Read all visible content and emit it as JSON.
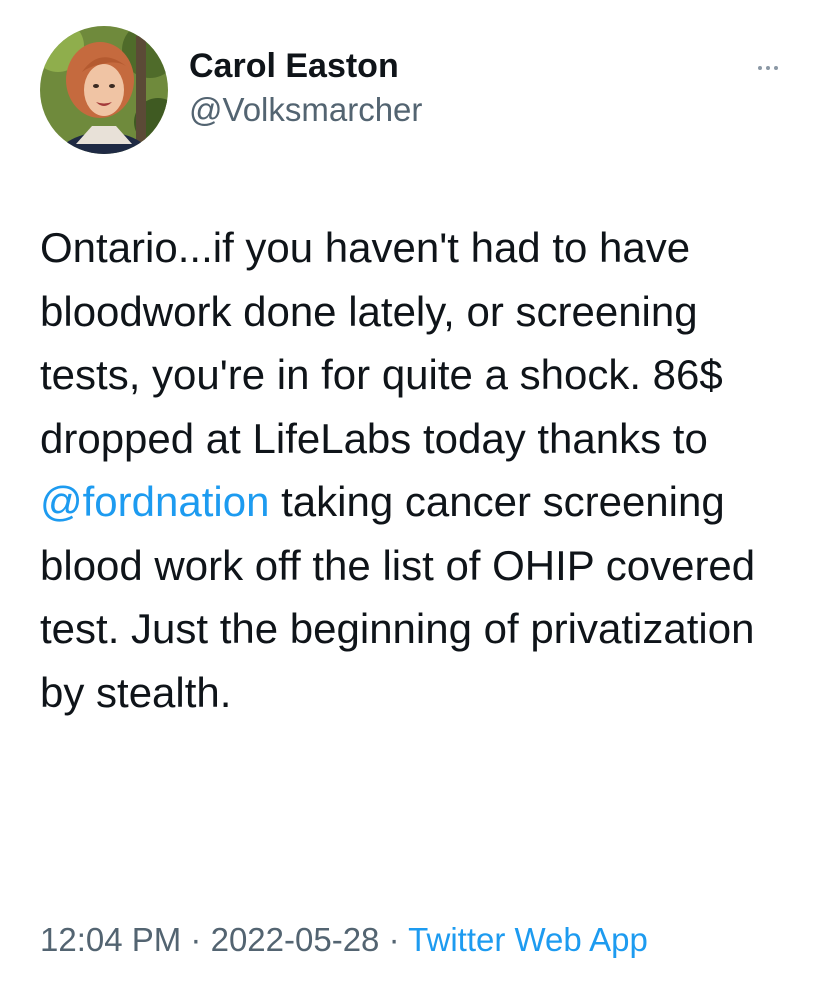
{
  "user": {
    "display_name": "Carol Easton",
    "handle": "@Volksmarcher"
  },
  "menu": {
    "icon": "more-horizontal-icon"
  },
  "tweet": {
    "text_before": "Ontario...if you haven't had to have bloodwork done lately, or screening tests, you're in for quite a shock. 86$ dropped at LifeLabs today thanks to ",
    "mention": "@fordnation",
    "text_after": " taking cancer screening blood work off the list of OHIP covered test. Just the beginning of privatization by stealth.",
    "time": "12:04 PM",
    "separator": "·",
    "date": "2022-05-28",
    "source": "Twitter Web App"
  },
  "colors": {
    "link": "#1d9bf0",
    "secondary_text": "#536471",
    "primary_text": "#0f1419"
  }
}
